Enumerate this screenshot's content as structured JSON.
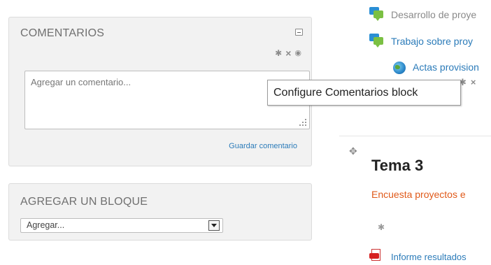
{
  "comments_block": {
    "title": "COMENTARIOS",
    "placeholder": "Agregar un comentario...",
    "save_link": "Guardar comentario"
  },
  "add_block": {
    "title": "AGREGAR UN BLOQUE",
    "selected": "Agregar..."
  },
  "activities": [
    {
      "label": "Desarrollo de proye",
      "icon": "forum-icon"
    },
    {
      "label": "Trabajo sobre proy",
      "icon": "forum-icon"
    },
    {
      "label": "Actas provision",
      "icon": "url-globe-icon"
    }
  ],
  "tooltip": "Configure Comentarios block",
  "section": {
    "title": "Tema 3",
    "survey": "Encuesta proyectos e",
    "report": "Informe resultados"
  },
  "colors": {
    "link": "#2b7bb9",
    "survey_orange": "#e05a1a",
    "block_bg": "#f2f2f2"
  }
}
